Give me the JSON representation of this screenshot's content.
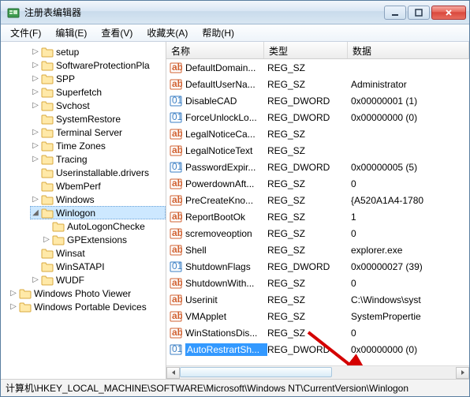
{
  "window": {
    "title": "注册表编辑器"
  },
  "menu": {
    "file": "文件(F)",
    "edit": "编辑(E)",
    "view": "查看(V)",
    "favorites": "收藏夹(A)",
    "help": "帮助(H)"
  },
  "tree": {
    "items": [
      {
        "label": "setup",
        "tw": "▷"
      },
      {
        "label": "SoftwareProtectionPla",
        "tw": "▷"
      },
      {
        "label": "SPP",
        "tw": "▷"
      },
      {
        "label": "Superfetch",
        "tw": "▷"
      },
      {
        "label": "Svchost",
        "tw": "▷"
      },
      {
        "label": "SystemRestore",
        "tw": ""
      },
      {
        "label": "Terminal Server",
        "tw": "▷"
      },
      {
        "label": "Time Zones",
        "tw": "▷"
      },
      {
        "label": "Tracing",
        "tw": "▷"
      },
      {
        "label": "Userinstallable.drivers",
        "tw": ""
      },
      {
        "label": "WbemPerf",
        "tw": ""
      },
      {
        "label": "Windows",
        "tw": "▷"
      },
      {
        "label": "Winlogon",
        "tw": "◢",
        "selected": true,
        "children": [
          {
            "label": "AutoLogonChecke",
            "tw": ""
          },
          {
            "label": "GPExtensions",
            "tw": "▷"
          }
        ]
      },
      {
        "label": "Winsat",
        "tw": ""
      },
      {
        "label": "WinSATAPI",
        "tw": ""
      },
      {
        "label": "WUDF",
        "tw": "▷"
      }
    ],
    "bottom": [
      {
        "label": "Windows Photo Viewer",
        "tw": "▷"
      },
      {
        "label": "Windows Portable Devices",
        "tw": "▷"
      }
    ]
  },
  "columns": {
    "name": "名称",
    "type": "类型",
    "data": "数据"
  },
  "values": [
    {
      "icon": "sz",
      "name": "DefaultDomain...",
      "type": "REG_SZ",
      "data": ""
    },
    {
      "icon": "sz",
      "name": "DefaultUserNa...",
      "type": "REG_SZ",
      "data": "Administrator"
    },
    {
      "icon": "dw",
      "name": "DisableCAD",
      "type": "REG_DWORD",
      "data": "0x00000001 (1)"
    },
    {
      "icon": "dw",
      "name": "ForceUnlockLo...",
      "type": "REG_DWORD",
      "data": "0x00000000 (0)"
    },
    {
      "icon": "sz",
      "name": "LegalNoticeCa...",
      "type": "REG_SZ",
      "data": ""
    },
    {
      "icon": "sz",
      "name": "LegalNoticeText",
      "type": "REG_SZ",
      "data": ""
    },
    {
      "icon": "dw",
      "name": "PasswordExpir...",
      "type": "REG_DWORD",
      "data": "0x00000005 (5)"
    },
    {
      "icon": "sz",
      "name": "PowerdownAft...",
      "type": "REG_SZ",
      "data": "0"
    },
    {
      "icon": "sz",
      "name": "PreCreateKno...",
      "type": "REG_SZ",
      "data": "{A520A1A4-1780"
    },
    {
      "icon": "sz",
      "name": "ReportBootOk",
      "type": "REG_SZ",
      "data": "1"
    },
    {
      "icon": "sz",
      "name": "scremoveoption",
      "type": "REG_SZ",
      "data": "0"
    },
    {
      "icon": "sz",
      "name": "Shell",
      "type": "REG_SZ",
      "data": "explorer.exe"
    },
    {
      "icon": "dw",
      "name": "ShutdownFlags",
      "type": "REG_DWORD",
      "data": "0x00000027 (39)"
    },
    {
      "icon": "sz",
      "name": "ShutdownWith...",
      "type": "REG_SZ",
      "data": "0"
    },
    {
      "icon": "sz",
      "name": "Userinit",
      "type": "REG_SZ",
      "data": "C:\\Windows\\syst"
    },
    {
      "icon": "sz",
      "name": "VMApplet",
      "type": "REG_SZ",
      "data": "SystemPropertie"
    },
    {
      "icon": "sz",
      "name": "WinStationsDis...",
      "type": "REG_SZ",
      "data": "0"
    },
    {
      "icon": "dw",
      "name": "AutoRestrartSh...",
      "type": "REG_DWORD",
      "data": "0x00000000 (0)",
      "selected": true
    }
  ],
  "statusbar": "计算机\\HKEY_LOCAL_MACHINE\\SOFTWARE\\Microsoft\\Windows NT\\CurrentVersion\\Winlogon"
}
